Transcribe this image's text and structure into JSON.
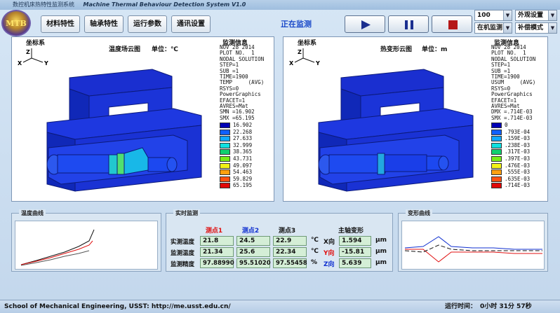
{
  "window": {
    "title_cn": "数控机床热特性监测系统",
    "title_en": "Machine Thermal Behaviour Detection System V1.0",
    "logo_text": "MTB"
  },
  "toolbar": {
    "buttons": [
      "材料特性",
      "轴承特性",
      "运行参数",
      "通讯设置"
    ],
    "status": "正在监测",
    "selects": [
      {
        "value": "100"
      },
      {
        "value": "外观设置"
      },
      {
        "value": "在机监测"
      },
      {
        "value": "补偿模式"
      }
    ]
  },
  "colors": {
    "accent": "#1848c8",
    "play": "#1b2f8f",
    "pause": "#1b2f8f",
    "stop": "#b51818",
    "point1": "#e01010",
    "point2": "#1030d0",
    "x_dir": "#111111",
    "y_dir": "#e01010",
    "z_dir": "#1030d0"
  },
  "thermal_panel": {
    "coord_label": "坐标系",
    "title": "温度场云图",
    "unit": "单位：℃",
    "info_title": "监测信息",
    "info_lines": [
      "NOV 28 2014",
      "PLOT NO.  1",
      "NODAL SOLUTION",
      "STEP=1",
      "SUB =1",
      "TIME=1900",
      "TEMP     (AVG)",
      "RSYS=0",
      "PowerGraphics",
      "EFACET=1",
      "AVRES=Mat",
      "SMN =16.902",
      "SMX =65.195"
    ],
    "legend": [
      {
        "color": "#0000b4",
        "value": "16.902"
      },
      {
        "color": "#1060ff",
        "value": "22.268"
      },
      {
        "color": "#11a8ff",
        "value": "27.633"
      },
      {
        "color": "#10e0e0",
        "value": "32.999"
      },
      {
        "color": "#10d070",
        "value": "38.365"
      },
      {
        "color": "#78ee18",
        "value": "43.731"
      },
      {
        "color": "#f2f216",
        "value": "49.097"
      },
      {
        "color": "#ffa010",
        "value": "54.463"
      },
      {
        "color": "#ff5010",
        "value": "59.829"
      },
      {
        "color": "#e00808",
        "value": "65.195"
      }
    ]
  },
  "deform_panel": {
    "coord_label": "坐标系",
    "title": "热变形云图",
    "unit": "单位：m",
    "info_title": "监测信息",
    "info_lines": [
      "NOV 28 2014",
      "PLOT NO.  1",
      "NODAL SOLUTION",
      "STEP=1",
      "SUB =1",
      "TIME=1900",
      "USUM     (AVG)",
      "RSYS=0",
      "PowerGraphics",
      "EFACET=1",
      "AVRES=Mat",
      "DMX =.714E-03",
      "SMX =.714E-03"
    ],
    "legend": [
      {
        "color": "#0000b4",
        "value": "0"
      },
      {
        "color": "#1060ff",
        "value": ".793E-04"
      },
      {
        "color": "#11a8ff",
        "value": ".159E-03"
      },
      {
        "color": "#10e0e0",
        "value": ".238E-03"
      },
      {
        "color": "#10d070",
        "value": ".317E-03"
      },
      {
        "color": "#78ee18",
        "value": ".397E-03"
      },
      {
        "color": "#f2f216",
        "value": ".476E-03"
      },
      {
        "color": "#ffa010",
        "value": ".555E-03"
      },
      {
        "color": "#ff5010",
        "value": ".635E-03"
      },
      {
        "color": "#e00808",
        "value": ".714E-03"
      }
    ]
  },
  "axis_labels": {
    "x": "X",
    "y": "Y",
    "z": "Z"
  },
  "temp_curve": {
    "title": "温度曲线"
  },
  "deform_curve": {
    "title": "变形曲线"
  },
  "realtime": {
    "title": "实时监测",
    "col_headers": [
      "测点1",
      "测点2",
      "测点3"
    ],
    "def_header": "主轴变形",
    "rows": [
      {
        "label": "实测温度",
        "values": [
          "21.8",
          "24.5",
          "22.9"
        ],
        "unit": "℃",
        "dir": "X向",
        "def": "1.594",
        "def_unit": "μm"
      },
      {
        "label": "监测温度",
        "values": [
          "21.34",
          "25.6",
          "22.34"
        ],
        "unit": "℃",
        "dir": "Y向",
        "def": "-15.81",
        "def_unit": "μm"
      },
      {
        "label": "监测精度",
        "values": [
          "97.88990",
          "95.51020",
          "97.55458"
        ],
        "unit": "%",
        "dir": "Z向",
        "def": "5.639",
        "def_unit": "μm"
      }
    ]
  },
  "status": {
    "school": "School of Mechanical Engineering, USST: http://me.usst.edu.cn/",
    "runtime_label": "运行时间：",
    "runtime": "0小时  31分  57秒"
  }
}
